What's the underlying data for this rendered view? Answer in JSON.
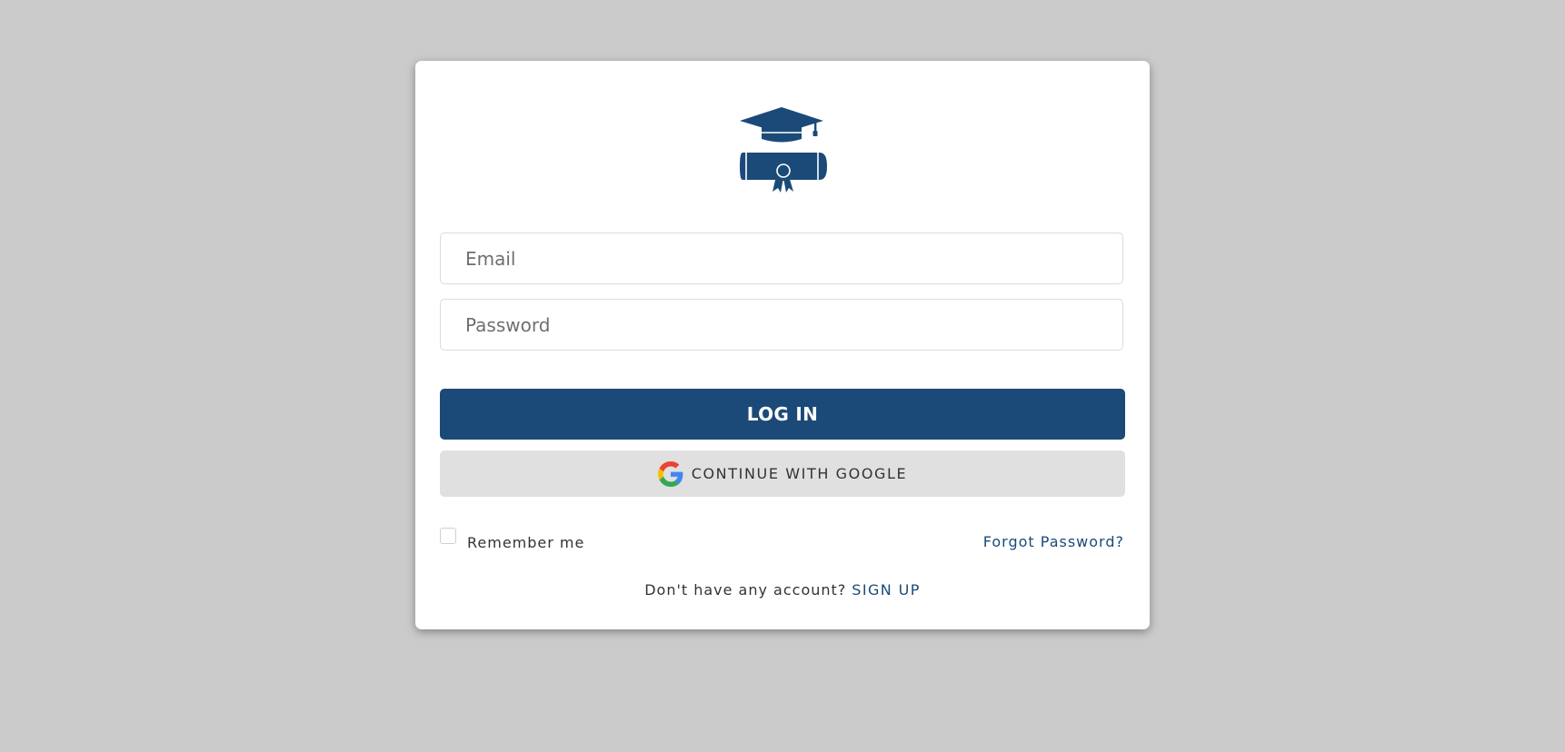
{
  "login": {
    "email_placeholder": "Email",
    "password_placeholder": "Password",
    "login_label": "LOG IN",
    "google_label": "CONTINUE WITH GOOGLE",
    "remember_label": "Remember me",
    "remember_checked": false,
    "forgot_label": "Forgot Password?",
    "signup_prompt": "Don't have any account?",
    "signup_label": "SIGN UP"
  },
  "icons": {
    "logo": "graduation-cap-diploma-icon",
    "google": "google-g-icon"
  },
  "colors": {
    "background": "#cbcbcb",
    "card": "#ffffff",
    "primary": "#1b4a78",
    "google_button": "#e0e0e0",
    "text": "#333333"
  }
}
